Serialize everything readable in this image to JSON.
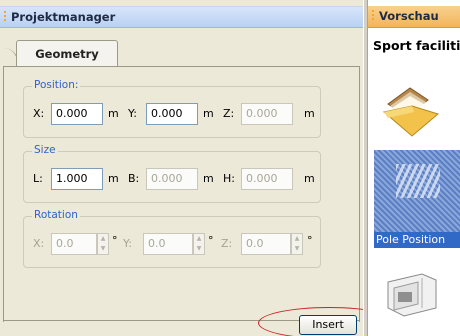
{
  "left_panel": {
    "title": "Projektmanager",
    "tab": "Geometry",
    "position": {
      "title": "Position:",
      "x_label": "X:",
      "x_value": "0.000",
      "x_unit": "m",
      "y_label": "Y:",
      "y_value": "0.000",
      "y_unit": "m",
      "z_label": "Z:",
      "z_value": "0.000",
      "z_unit": "m"
    },
    "size": {
      "title": "Size",
      "l_label": "L:",
      "l_value": "1.000",
      "l_unit": "m",
      "b_label": "B:",
      "b_value": "0.000",
      "b_unit": "m",
      "h_label": "H:",
      "h_value": "0.000",
      "h_unit": "m"
    },
    "rotation": {
      "title": "Rotation",
      "x_label": "X:",
      "x_value": "0.0",
      "x_unit": "°",
      "y_label": "Y:",
      "y_value": "0.0",
      "y_unit": "°",
      "z_label": "Z:",
      "z_value": "0.0",
      "z_unit": "°"
    },
    "insert_label": "Insert"
  },
  "right_panel": {
    "title": "Vorschau",
    "heading": "Sport faciliti",
    "item_label": "Pole Position"
  },
  "colors": {
    "header_blue": "#c7dbf7",
    "header_orange": "#f6c170",
    "group_title": "#2c64c8",
    "selection": "#3169c6",
    "highlight_ellipse": "#cc2222"
  },
  "icons": [
    "folder-icon",
    "gallery-icon",
    "spin-up-icon",
    "spin-down-icon"
  ]
}
